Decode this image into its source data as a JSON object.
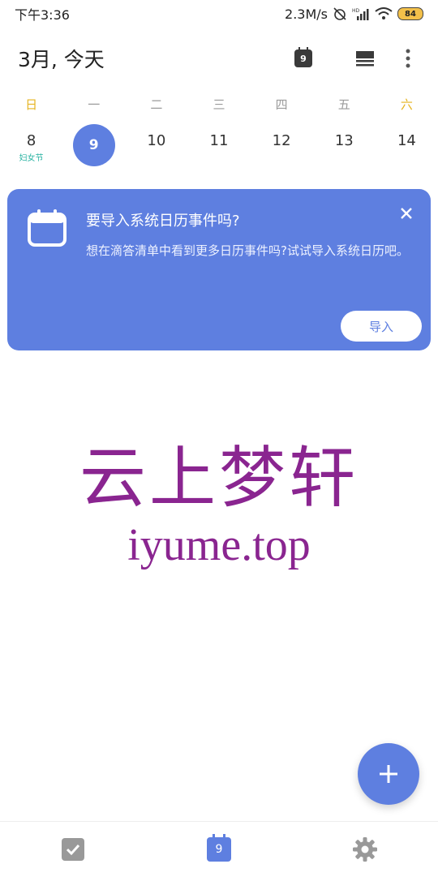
{
  "status_bar": {
    "time": "下午3:36",
    "speed": "2.3M/s",
    "network_label": "HD",
    "battery": "84",
    "icons": [
      "alarm-off-icon",
      "signal-icon",
      "wifi-icon",
      "battery-icon"
    ]
  },
  "header": {
    "title": "3月, 今天",
    "today_badge": "9",
    "icons": [
      "today-calendar-icon",
      "view-mode-icon",
      "more-icon"
    ]
  },
  "week": {
    "weekdays": [
      "日",
      "一",
      "二",
      "三",
      "四",
      "五",
      "六"
    ],
    "dates": [
      {
        "day": "8",
        "sub": "妇女节"
      },
      {
        "day": "9",
        "sub": ""
      },
      {
        "day": "10",
        "sub": ""
      },
      {
        "day": "11",
        "sub": ""
      },
      {
        "day": "12",
        "sub": ""
      },
      {
        "day": "13",
        "sub": ""
      },
      {
        "day": "14",
        "sub": ""
      }
    ],
    "selected_index": 1
  },
  "banner": {
    "title": "要导入系统日历事件吗?",
    "body": "想在滴答清单中看到更多日历事件吗?试试导入系统日历吧。",
    "import_label": "导入",
    "icons": [
      "calendar-outline-icon",
      "close-icon"
    ]
  },
  "watermark": {
    "cn": "云上梦轩",
    "en": "iyume.top"
  },
  "fab": {
    "icon": "plus-icon"
  },
  "bottom_nav": {
    "items": [
      {
        "name": "tasks",
        "icon": "checkbox-icon"
      },
      {
        "name": "calendar",
        "icon": "calendar-icon",
        "badge": "9"
      },
      {
        "name": "settings",
        "icon": "gear-icon"
      }
    ]
  },
  "colors": {
    "accent": "#5e7fe0",
    "weekend": "#e6b422",
    "holiday": "#2bb3a3",
    "watermark": "#8a2590"
  }
}
